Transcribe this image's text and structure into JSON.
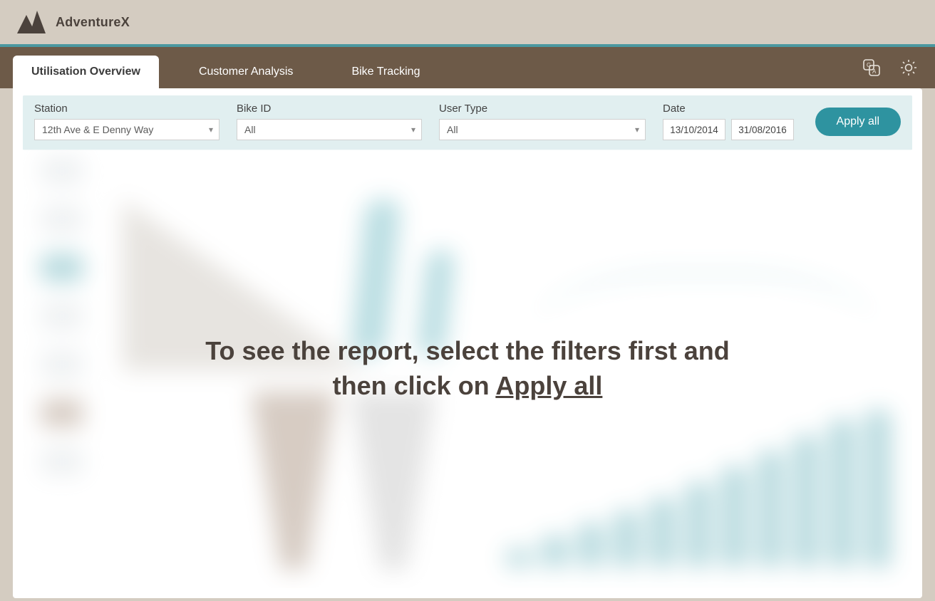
{
  "brand": {
    "name": "AdventureX"
  },
  "tabs": [
    {
      "label": "Utilisation Overview",
      "active": true
    },
    {
      "label": "Customer Analysis",
      "active": false
    },
    {
      "label": "Bike Tracking",
      "active": false
    }
  ],
  "filters": {
    "station": {
      "label": "Station",
      "value": "12th Ave & E Denny Way"
    },
    "bike_id": {
      "label": "Bike ID",
      "value": "All"
    },
    "user_type": {
      "label": "User Type",
      "value": "All"
    },
    "date": {
      "label": "Date",
      "from": "13/10/2014",
      "to": "31/08/2016"
    }
  },
  "apply_button": "Apply all",
  "overlay": {
    "line1": "To see the report, select the filters first and",
    "line2_prefix": "then click on ",
    "line2_link": "Apply all"
  },
  "colors": {
    "accent_teal": "#2e93a0",
    "tabbar_brown": "#6d5a48",
    "bg_beige": "#d4ccc1",
    "filterbar": "#e1eff0"
  }
}
